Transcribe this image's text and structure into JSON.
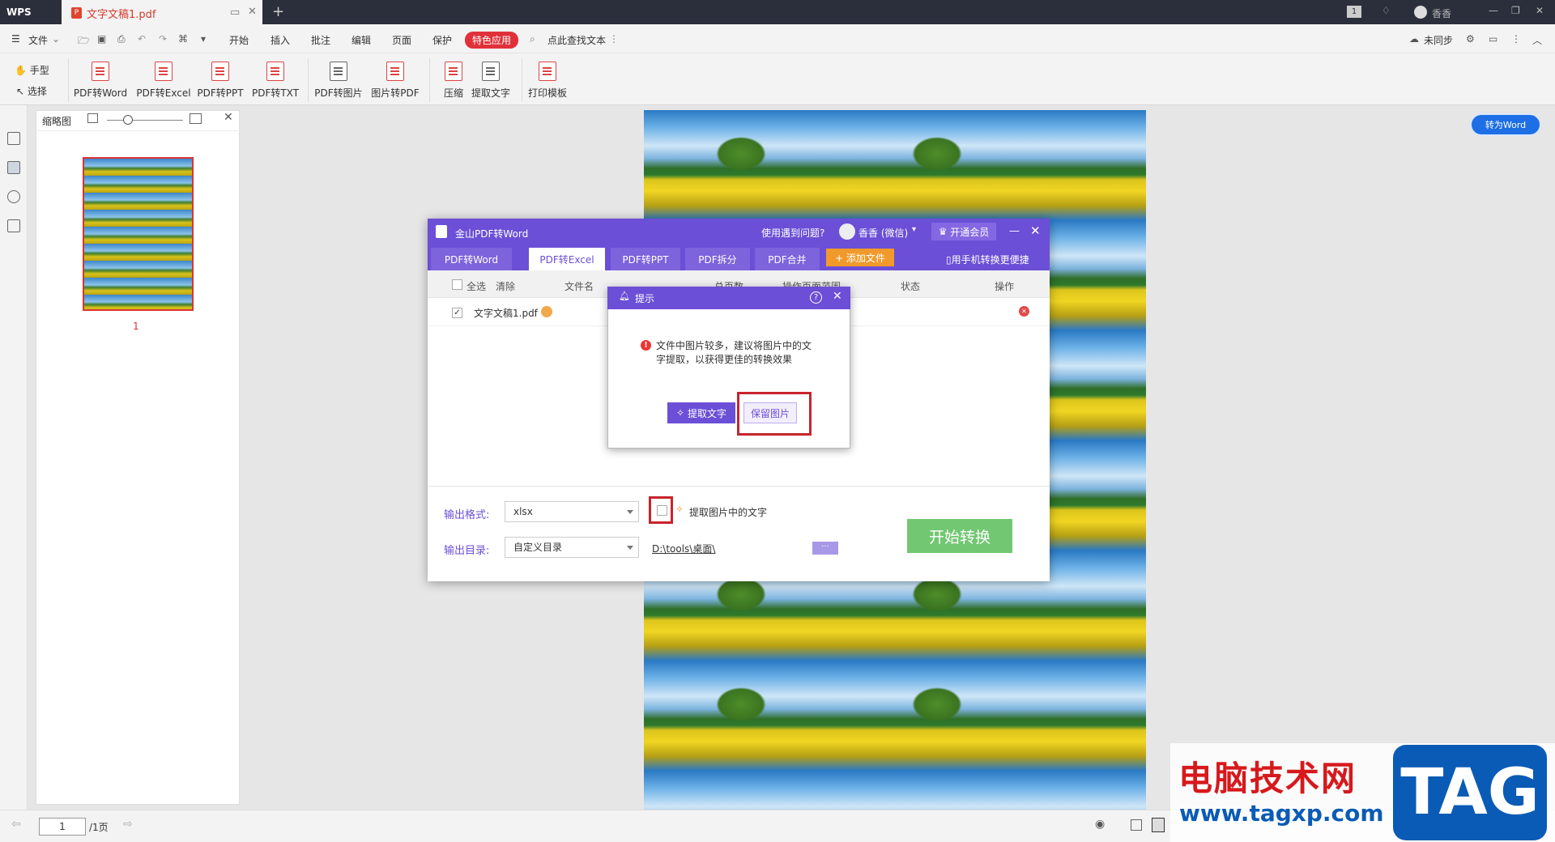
{
  "titlebar": {
    "app_tab": "WPS",
    "doc_tab": "文字文稿1.pdf",
    "user": "香香",
    "page_badge": "1"
  },
  "menubar": {
    "file": "文件",
    "items": [
      "开始",
      "插入",
      "批注",
      "编辑",
      "页面",
      "保护"
    ],
    "special": "特色应用",
    "search": "点此查找文本",
    "sync": "未同步"
  },
  "ribbon": {
    "hand": "手型",
    "select": "选择",
    "buttons": [
      "PDF转Word",
      "PDF转Excel",
      "PDF转PPT",
      "PDF转TXT",
      "PDF转图片",
      "图片转PDF",
      "压缩",
      "提取文字",
      "打印模板"
    ]
  },
  "thumbs": {
    "title": "缩略图",
    "page_no": "1"
  },
  "viewer": {
    "to_word": "转为Word"
  },
  "statusbar": {
    "page_value": "1",
    "page_total": "/1页"
  },
  "dialog": {
    "title": "金山PDF转Word",
    "help": "使用遇到问题?",
    "user": "香香 (微信)",
    "vip": "开通会员",
    "tabs": [
      "PDF转Word",
      "PDF转Excel",
      "PDF转PPT",
      "PDF拆分",
      "PDF合并"
    ],
    "add_file": "+ 添加文件",
    "mobile": "用手机转换更便捷",
    "columns": {
      "select_all": "全选",
      "clear": "清除",
      "filename": "文件名",
      "pages": "总页数",
      "range": "操作页面范围",
      "status": "状态",
      "action": "操作"
    },
    "file": {
      "name": "文字文稿1.pdf"
    },
    "output_format_label": "输出格式:",
    "output_format": "xlsx",
    "extract_label": "提取图片中的文字",
    "output_dir_label": "输出目录:",
    "output_dir": "自定义目录",
    "path": "D:\\tools\\桌面\\",
    "more": "···",
    "start": "开始转换"
  },
  "prompt": {
    "title": "提示",
    "message": "文件中图片较多，建议将图片中的文字提取，以获得更佳的转换效果",
    "extract": "提取文字",
    "keep": "保留图片"
  },
  "watermark": {
    "cn": "电脑技术网",
    "url": "www.tagxp.com",
    "tag": "TAG"
  }
}
